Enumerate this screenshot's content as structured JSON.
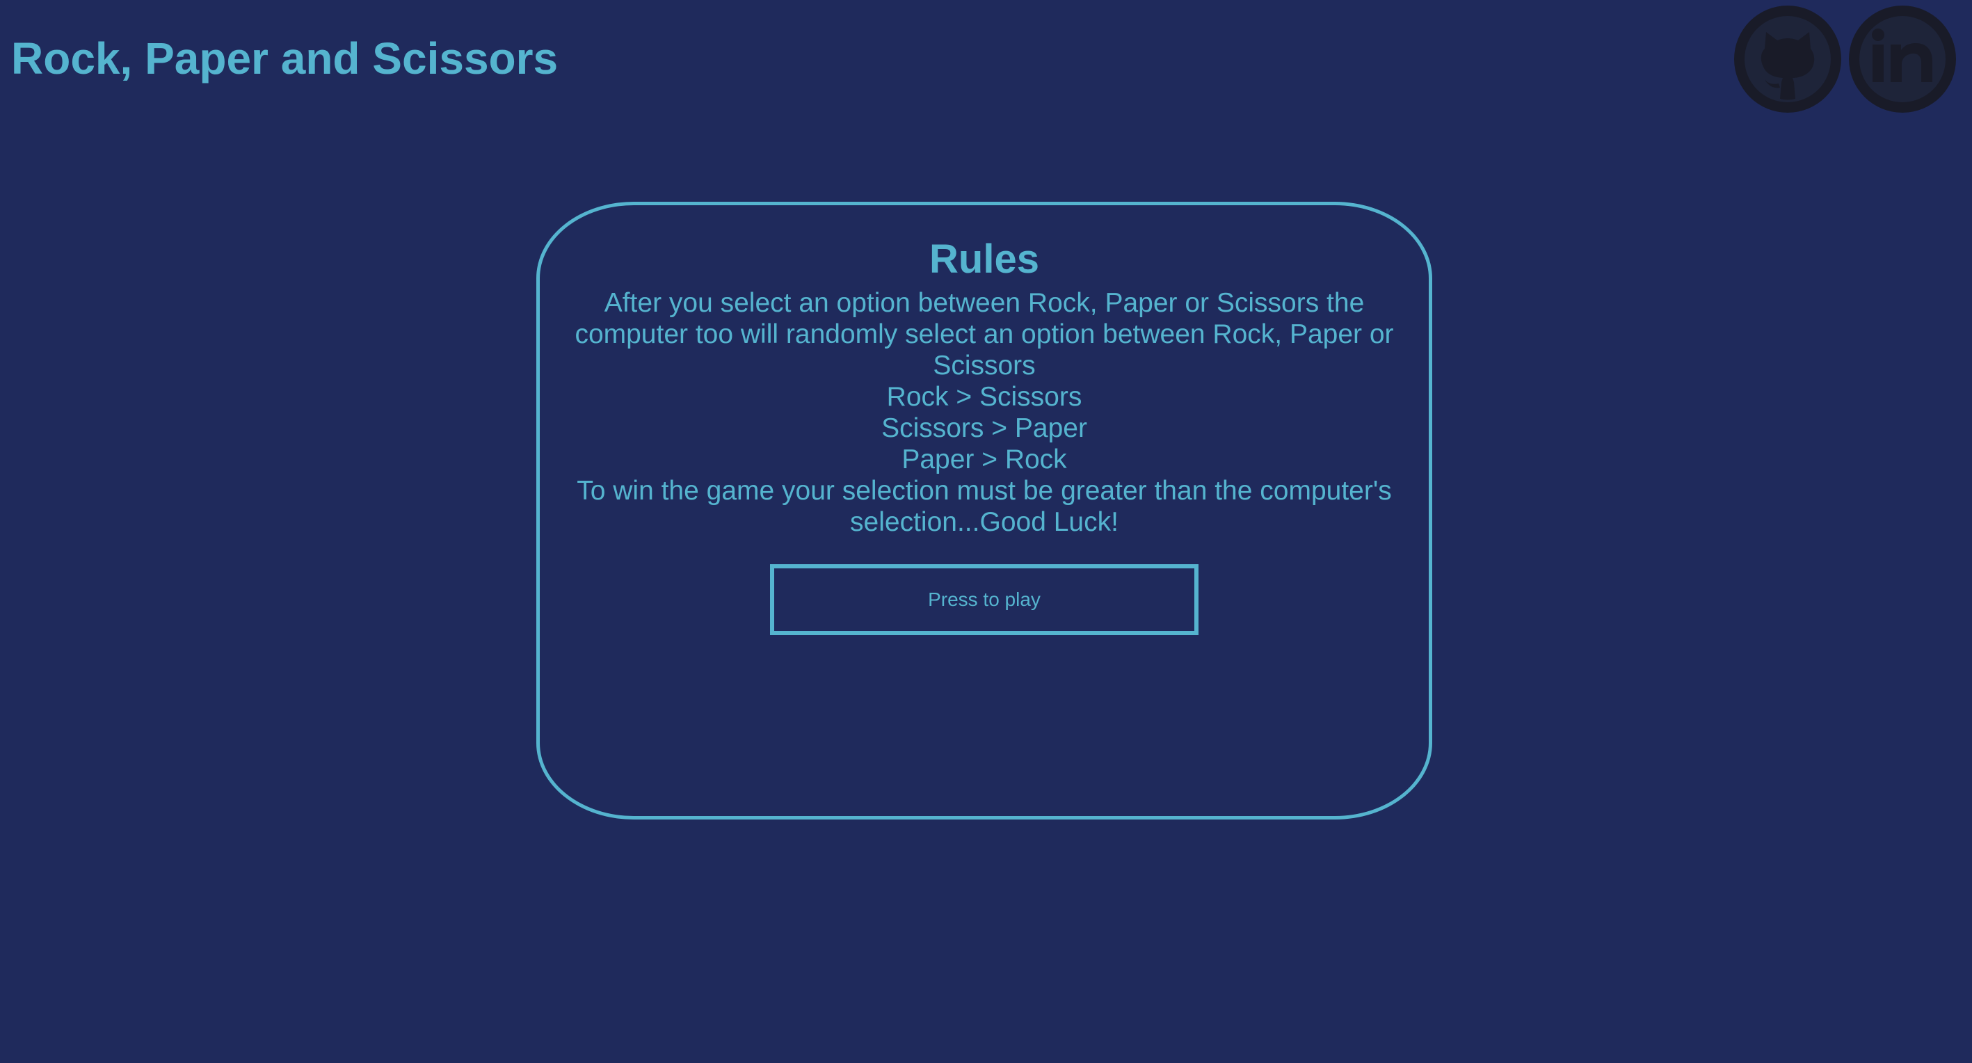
{
  "header": {
    "title": "Rock, Paper and Scissors",
    "social_links": [
      {
        "name": "github",
        "icon": "github-icon"
      },
      {
        "name": "linkedin",
        "icon": "linkedin-icon"
      }
    ]
  },
  "rules": {
    "heading": "Rules",
    "intro": "After you select an option between Rock, Paper or Scissors the computer too will randomly select an option between Rock, Paper or Scissors",
    "rule_1": "Rock > Scissors",
    "rule_2": "Scissors > Paper",
    "rule_3": "Paper > Rock",
    "outro": "To win the game your selection must be greater than the computer's selection...Good Luck!",
    "play_button_label": "Press to play"
  },
  "colors": {
    "background": "#1f2a5c",
    "accent": "#55b4cf",
    "icon_background": "#191b28"
  }
}
